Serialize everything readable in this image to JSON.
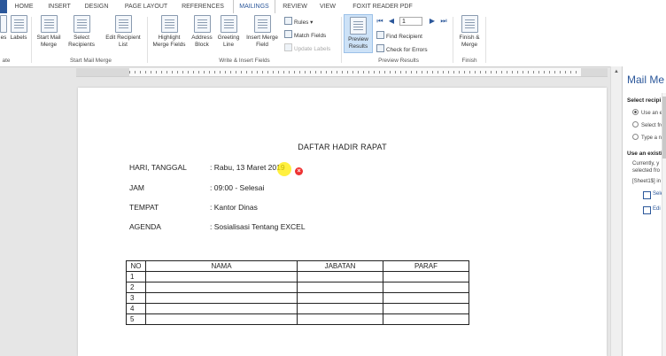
{
  "tabs": {
    "file": "",
    "home": "HOME",
    "insert": "INSERT",
    "design": "DESIGN",
    "page_layout": "PAGE LAYOUT",
    "references": "REFERENCES",
    "mailings": "MAILINGS",
    "review": "REVIEW",
    "view": "VIEW",
    "foxit": "FOXIT READER PDF"
  },
  "ribbon": {
    "envelopes": "es",
    "labels": "Labels",
    "group_create": "ate",
    "start_mail_merge": "Start Mail Merge",
    "select_recipients": "Select Recipients",
    "edit_recipient_list": "Edit Recipient List",
    "group_start": "Start Mail Merge",
    "highlight_merge_fields": "Highlight Merge Fields",
    "address_block": "Address Block",
    "greeting_line": "Greeting Line",
    "insert_merge_field": "Insert Merge Field",
    "rules": "Rules",
    "match_fields": "Match Fields",
    "update_labels": "Update Labels",
    "group_write": "Write & Insert Fields",
    "preview_results": "Preview Results",
    "record_number": "1",
    "find_recipient": "Find Recipient",
    "check_for_errors": "Check for Errors",
    "group_preview": "Preview Results",
    "finish_merge": "Finish & Merge",
    "group_finish": "Finish"
  },
  "document": {
    "title": "DAFTAR HADIR RAPAT",
    "rows": [
      {
        "label": "HARI, TANGGAL",
        "value": ": Rabu, 13 Maret 2019"
      },
      {
        "label": "JAM",
        "value": ": 09:00 - Selesai"
      },
      {
        "label": "TEMPAT",
        "value": ": Kantor Dinas"
      },
      {
        "label": "AGENDA",
        "value": ": Sosialisasi Tentang EXCEL"
      }
    ],
    "table": {
      "headers": [
        "NO",
        "NAMA",
        "JABATAN",
        "PARAF"
      ],
      "numbers": [
        "1",
        "2",
        "3",
        "4",
        "5"
      ]
    }
  },
  "pane": {
    "title": "Mail Me",
    "select_heading": "Select recipi",
    "opt_existing": "Use an e",
    "opt_select": "Select fro",
    "opt_type": "Type a n",
    "use_heading": "Use an existi",
    "desc1": "Currently, y",
    "desc2": "selected fro",
    "sheet": "[Sheet1$] in",
    "link_select": "Sele",
    "link_edit": "Edi"
  },
  "colors": {
    "accent": "#2b579a",
    "preview_active": "#cde2f7",
    "cursor_highlight": "#ffeb00",
    "error_dot": "#e33333"
  }
}
